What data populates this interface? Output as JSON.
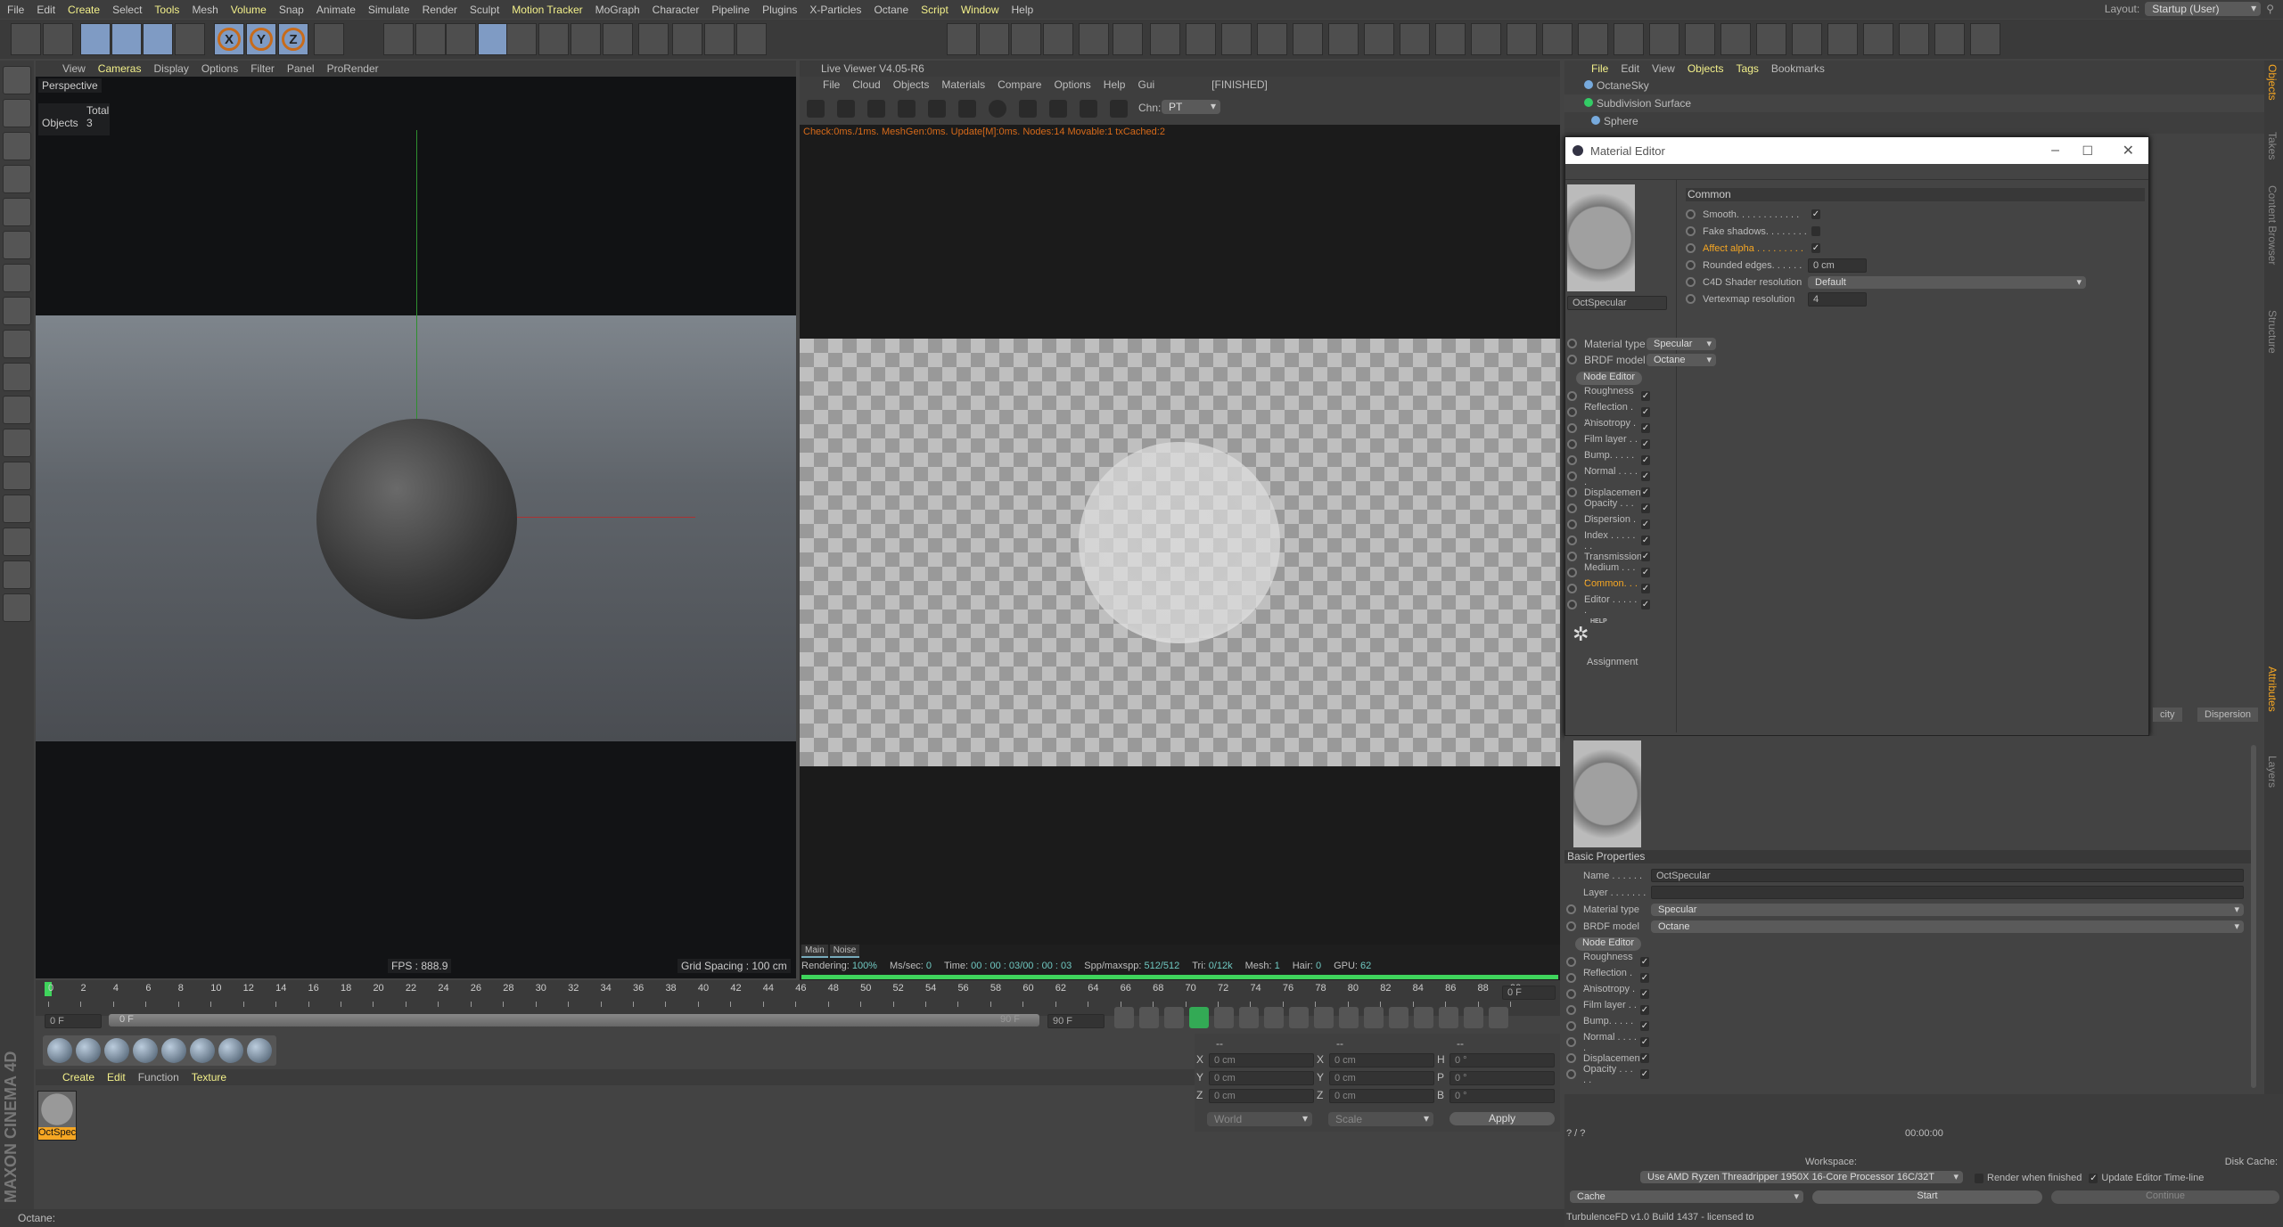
{
  "menu": [
    "File",
    "Edit",
    "Create",
    "Select",
    "Tools",
    "Mesh",
    "Volume",
    "Snap",
    "Animate",
    "Simulate",
    "Render",
    "Sculpt",
    "Motion Tracker",
    "MoGraph",
    "Character",
    "Pipeline",
    "Plugins",
    "X-Particles",
    "Octane",
    "Script",
    "Window",
    "Help"
  ],
  "menu_highlight": [
    "Create",
    "Tools",
    "Volume",
    "Motion Tracker",
    "Script",
    "Window"
  ],
  "layout": {
    "label": "Layout:",
    "value": "Startup (User)"
  },
  "toolbar_axes": [
    "X",
    "Y",
    "Z"
  ],
  "viewport": {
    "menu": [
      "View",
      "Cameras",
      "Display",
      "Options",
      "Filter",
      "Panel",
      "ProRender"
    ],
    "camera": "Perspective",
    "stats_header": "Total",
    "stats_label": "Objects",
    "stats_value": "3",
    "fps": "FPS : 888.9",
    "grid": "Grid Spacing : 100 cm"
  },
  "live_viewer": {
    "title": "Live Viewer V4.05-R6",
    "menu": [
      "File",
      "Cloud",
      "Objects",
      "Materials",
      "Compare",
      "Options",
      "Help",
      "Gui"
    ],
    "state": "[FINISHED]",
    "chn_label": "Chn:",
    "chn_value": "PT",
    "log": "Check:0ms./1ms. MeshGen:0ms. Update[M]:0ms. Nodes:14 Movable:1 txCached:2",
    "tabs": [
      "Main",
      "Noise"
    ],
    "status": [
      [
        "Rendering:",
        "100%"
      ],
      [
        "Ms/sec:",
        "0"
      ],
      [
        "Time:",
        "00 : 00 : 03/00 : 00 : 03"
      ],
      [
        "Spp/maxspp:",
        "512/512"
      ],
      [
        "Tri:",
        "0/12k"
      ],
      [
        "Mesh:",
        "1"
      ],
      [
        "Hair:",
        "0"
      ],
      [
        "GPU:",
        "62"
      ]
    ],
    "progress": 100
  },
  "timeline": {
    "start": 0,
    "end": 90,
    "step": 2,
    "current_frame": "0 F",
    "end_field": "90 F",
    "range_left": "0 F",
    "range_right": "90 F",
    "right_field": "0 F"
  },
  "materials_menu": [
    "Create",
    "Edit",
    "Function",
    "Texture"
  ],
  "material_thumb": "OctSpec",
  "brand": "MAXON CINEMA 4D",
  "status_bar": "Octane:",
  "coords": {
    "headers": [
      "--",
      "--",
      "--"
    ],
    "rows": [
      [
        "X",
        "0 cm",
        "X",
        "0 cm",
        "H",
        "0 °"
      ],
      [
        "Y",
        "0 cm",
        "Y",
        "0 cm",
        "P",
        "0 °"
      ],
      [
        "Z",
        "0 cm",
        "Z",
        "0 cm",
        "B",
        "0 °"
      ]
    ],
    "mode1": "World",
    "mode2": "Scale",
    "apply": "Apply"
  },
  "objects_panel": {
    "menu": [
      "File",
      "Edit",
      "View",
      "Objects",
      "Tags",
      "Bookmarks"
    ],
    "items": [
      "OctaneSky",
      "Subdivision Surface",
      "Sphere"
    ]
  },
  "material_editor": {
    "title": "Material Editor",
    "name": "OctSpecular",
    "material_type_label": "Material type",
    "material_type": "Specular",
    "brdf_label": "BRDF model",
    "brdf": "Octane",
    "node_editor": "Node Editor",
    "channels": [
      "Roughness . .",
      "Reflection . . .",
      "Anisotropy . .",
      "Film layer . . .",
      "Bump. . . . . . .",
      "Normal . . . . .",
      "Displacement",
      "Opacity . . . . .",
      "Dispersion . .",
      "Index . . . . . . .",
      "Transmission",
      "Medium . . . .",
      "Common. . . .",
      "Editor . . . . . ."
    ],
    "active_channel": "Common. . . .",
    "help": "HELP",
    "assignment": "Assignment",
    "section": "Common",
    "common": [
      {
        "label": "Smooth. . . . . . . . . . . .",
        "type": "check",
        "value": true
      },
      {
        "label": "Fake shadows. . . . . . . .",
        "type": "check",
        "value": false
      },
      {
        "label": "Affect alpha . . . . . . . . .",
        "type": "check",
        "value": true,
        "active": true
      },
      {
        "label": "Rounded edges. . . . . .",
        "type": "num",
        "value": "0 cm"
      },
      {
        "label": "C4D Shader resolution",
        "type": "select",
        "value": "Default"
      },
      {
        "label": "Vertexmap resolution",
        "type": "num",
        "value": "4"
      }
    ]
  },
  "attributes": {
    "tabs": [
      "city",
      "Dispersion"
    ],
    "section": "Basic Properties",
    "name_label": "Name . . . . . .",
    "name": "OctSpecular",
    "layer_label": "Layer . . . . . . .",
    "material_type_label": "Material type",
    "material_type": "Specular",
    "brdf_label": "BRDF model",
    "brdf": "Octane",
    "node_editor": "Node Editor",
    "channels": [
      "Roughness . .",
      "Reflection . . .",
      "Anisotropy . .",
      "Film layer . . .",
      "Bump. . . . . . .",
      "Normal . . . . .",
      "Displacement",
      "Opacity . . . . ."
    ]
  },
  "render_panel": {
    "count": "? / ?",
    "time": "00:00:00",
    "workspace": "Workspace:",
    "disk_cache": "Disk Cache:",
    "device": "Use  AMD Ryzen Threadripper 1950X 16-Core Processor 16C/32T",
    "render_when_finished": "Render when finished",
    "update_timeline": "Update Editor Time-line",
    "cache": "Cache",
    "start": "Start",
    "continue": "Continue",
    "license": "TurbulenceFD v1.0 Build 1437 - licensed to"
  },
  "right_tabs": [
    "Objects",
    "Takes",
    "Content Browser",
    "Structure",
    "Attributes",
    "Layers"
  ],
  "colors": {
    "accent": "#f5a623",
    "menu_highlight": "#f3f08a",
    "progress": "#3fd45c",
    "log": "#d66a1a",
    "status_value": "#6fc7c0"
  }
}
